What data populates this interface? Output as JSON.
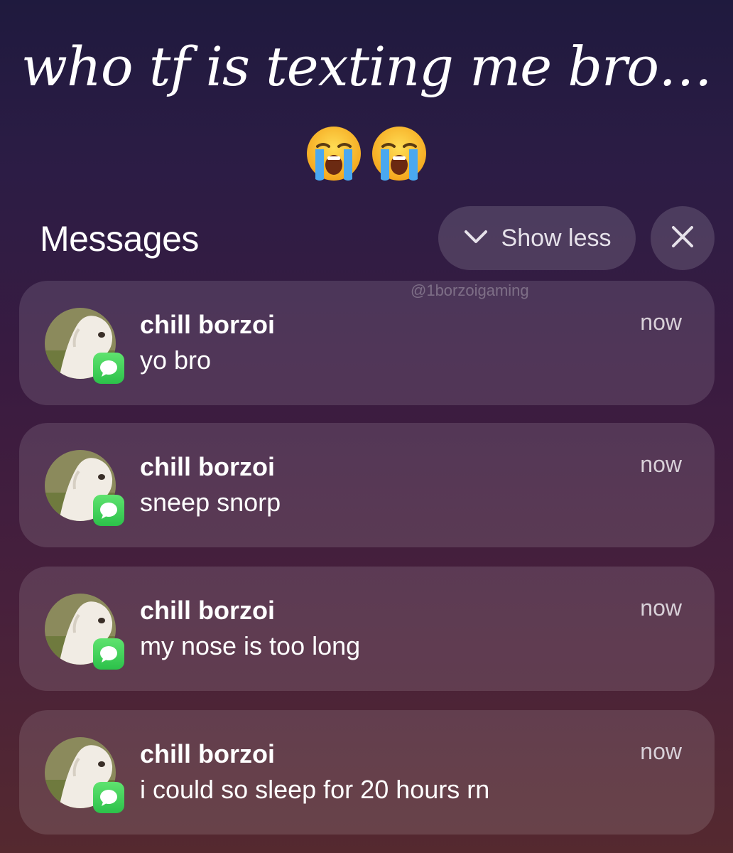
{
  "caption": "who tf is texting me bro…",
  "emoji": [
    "loudly-crying-face-icon",
    "loudly-crying-face-icon"
  ],
  "header": {
    "title": "Messages",
    "show_less_label": "Show less",
    "show_less_icon": "chevron-down-icon",
    "close_icon": "close-icon"
  },
  "watermark": "@1borzoigaming",
  "notifications": [
    {
      "sender": "chill borzoi",
      "body": "yo bro",
      "time": "now",
      "icon": "messages-app-icon",
      "avatar": "borzoi-avatar"
    },
    {
      "sender": "chill borzoi",
      "body": "sneep snorp",
      "time": "now",
      "icon": "messages-app-icon",
      "avatar": "borzoi-avatar"
    },
    {
      "sender": "chill borzoi",
      "body": "my nose is too long",
      "time": "now",
      "icon": "messages-app-icon",
      "avatar": "borzoi-avatar"
    },
    {
      "sender": "chill borzoi",
      "body": "i could so sleep for 20 hours rn",
      "time": "now",
      "icon": "messages-app-icon",
      "avatar": "borzoi-avatar"
    }
  ],
  "colors": {
    "badge_green": "#34c759",
    "card_bg": "rgba(255,255,255,0.12)"
  }
}
